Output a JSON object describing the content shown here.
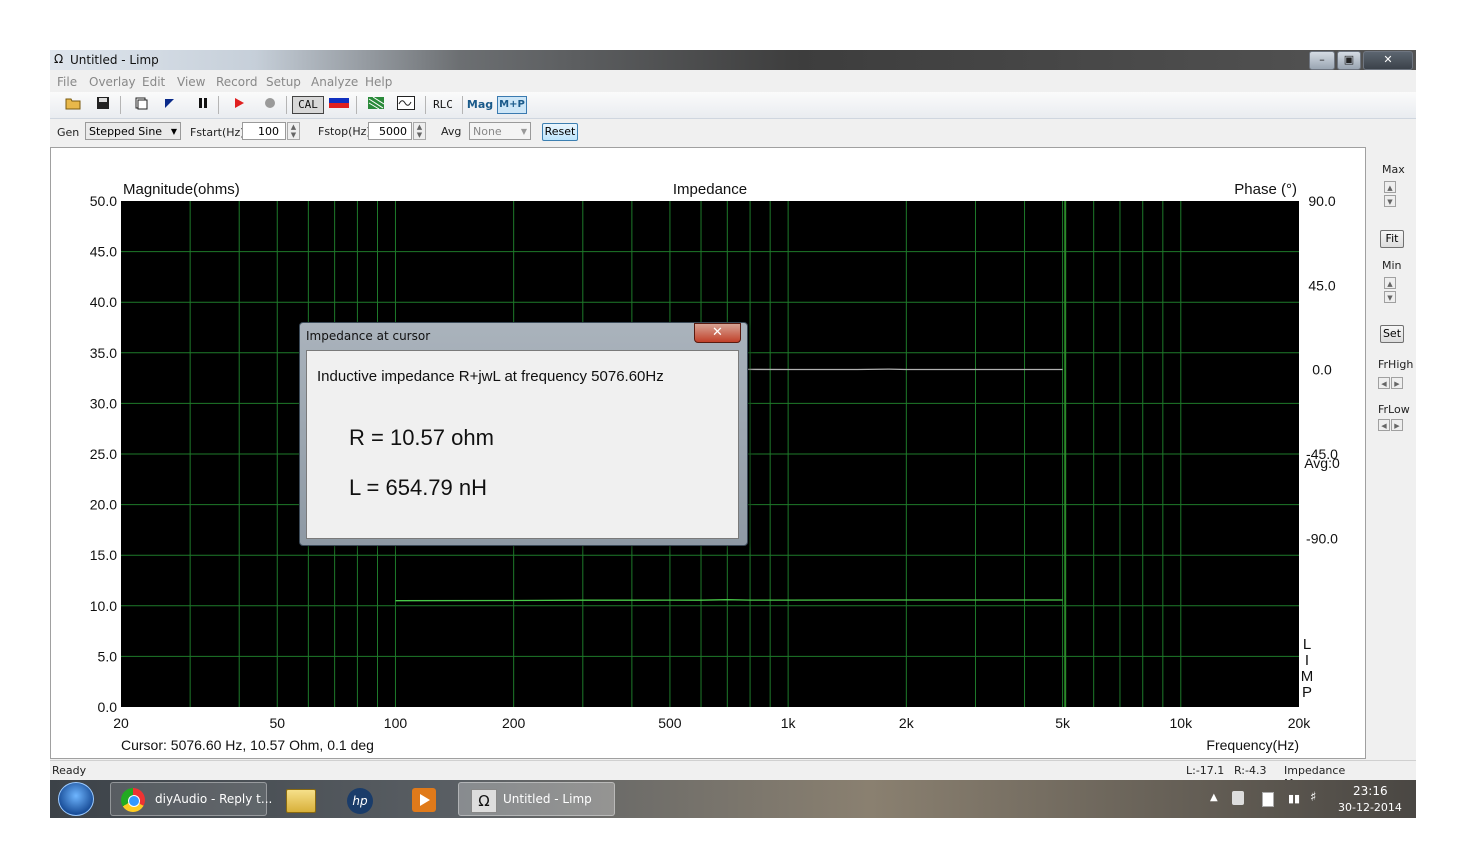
{
  "window": {
    "title": "Untitled - Limp",
    "title_icon": "omega-icon",
    "controls": [
      "minimize",
      "maximize",
      "close"
    ]
  },
  "menu": [
    "File",
    "Overlay",
    "Edit",
    "View",
    "Record",
    "Setup",
    "Analyze",
    "Help"
  ],
  "toolbar": {
    "cal_label": "CAL",
    "rlc_label": "RLC",
    "mag_label": "Mag",
    "mp_label": "M+P",
    "icons": [
      "open-folder-icon",
      "save-icon",
      "new-doc-icon",
      "marker-icon",
      "pause-icon",
      "record-icon",
      "stop-icon",
      "cal-icon",
      "color-bar-icon",
      "chart-icon",
      "wave-icon"
    ]
  },
  "params": {
    "gen_label": "Gen",
    "gen_value": "Stepped Sine",
    "fstart_label": "Fstart(Hz)",
    "fstart_value": "100",
    "fstop_label": "Fstop(Hz)",
    "fstop_value": "5000",
    "avg_label": "Avg",
    "avg_value": "None",
    "reset_label": "Reset"
  },
  "chart_data": {
    "type": "line",
    "title": "Impedance",
    "left_axis_label": "Magnitude(ohms)",
    "right_axis_label": "Phase (°)",
    "xlabel": "Frequency(Hz)",
    "x_scale": "log",
    "xlim": [
      20,
      20000
    ],
    "x_ticks": [
      20,
      50,
      100,
      200,
      500,
      1000,
      2000,
      5000,
      10000,
      20000
    ],
    "x_tick_labels": [
      "20",
      "50",
      "100",
      "200",
      "500",
      "1k",
      "2k",
      "5k",
      "10k",
      "20k"
    ],
    "ylim_left": [
      0,
      50
    ],
    "y_ticks_left": [
      "0.0",
      "5.0",
      "10.0",
      "15.0",
      "20.0",
      "25.0",
      "30.0",
      "35.0",
      "40.0",
      "45.0",
      "50.0"
    ],
    "ylim_right": [
      -180,
      90
    ],
    "y_ticks_right": [
      "90.0",
      "45.0",
      "0.0",
      "-45.0",
      "-90.0"
    ],
    "avg_label": "Avg:0",
    "brand_letters": [
      "L",
      "I",
      "M",
      "P"
    ],
    "cursor_text": "Cursor: 5076.60 Hz, 10.57 Ohm, 0.1 deg",
    "cursor_x": 5076.6,
    "grid": true,
    "colors": {
      "background": "#000000",
      "grid": "#1e7a2a",
      "magnitude": "#48c848",
      "phase": "#b0b0b0",
      "cursor": "#2a8a2a"
    },
    "series": [
      {
        "name": "Magnitude",
        "axis": "left",
        "x": [
          100,
          200,
          300,
          400,
          500,
          600,
          700,
          800,
          1000,
          1500,
          2000,
          3000,
          4000,
          5000
        ],
        "y": [
          10.5,
          10.52,
          10.55,
          10.55,
          10.56,
          10.55,
          10.6,
          10.56,
          10.56,
          10.57,
          10.57,
          10.57,
          10.57,
          10.57
        ]
      },
      {
        "name": "Phase",
        "axis": "right",
        "x": [
          100,
          150,
          200,
          300,
          400,
          500,
          700,
          1000,
          1500,
          1800,
          2000,
          3000,
          5000
        ],
        "y": [
          2.0,
          1.5,
          1.0,
          0.6,
          0.4,
          0.3,
          0.2,
          0.1,
          0.1,
          0.3,
          0.1,
          0.1,
          0.1
        ]
      }
    ]
  },
  "right_panel": {
    "max_label": "Max",
    "fit_label": "Fit",
    "min_label": "Min",
    "set_label": "Set",
    "frhigh_label": "FrHigh",
    "frlow_label": "FrLow"
  },
  "dialog": {
    "title": "Impedance at cursor",
    "close_label": "✕",
    "heading": "Inductive impedance R+jwL at frequency 5076.60Hz",
    "r_line": "R = 10.57 ohm",
    "l_line": "L = 654.79 nH"
  },
  "status": {
    "left": "Ready",
    "l_value": "L:-17.1",
    "r_value": "R:-4.3",
    "mode": "Impedance Measuremen"
  },
  "taskbar": {
    "start_icon": "windows-start-icon",
    "items": [
      {
        "icon": "chrome-icon",
        "label": "diyAudio - Reply t..."
      },
      {
        "icon": "file-explorer-icon",
        "label": ""
      },
      {
        "icon": "hp-icon",
        "label": ""
      },
      {
        "icon": "media-player-icon",
        "label": ""
      },
      {
        "icon": "omega-icon",
        "label": "Untitled - Limp"
      }
    ],
    "time": "23:16",
    "date": "30-12-2014",
    "tray_icons": [
      "tray-up-arrow-icon",
      "tray-flag-icon",
      "tray-device-icon",
      "tray-network-icon",
      "tray-volume-icon"
    ]
  }
}
